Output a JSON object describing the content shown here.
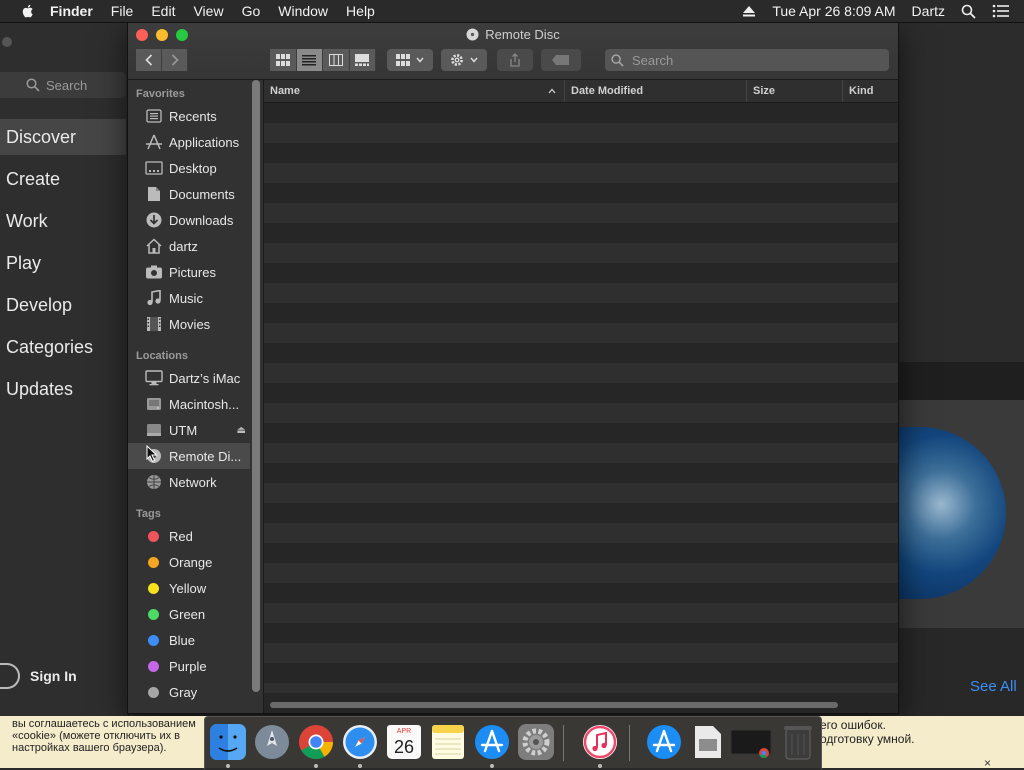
{
  "menubar": {
    "app_name": "Finder",
    "menus": [
      "File",
      "Edit",
      "View",
      "Go",
      "Window",
      "Help"
    ],
    "datetime": "Tue Apr 26  8:09 AM",
    "user": "Dartz"
  },
  "appstore": {
    "search_placeholder": "Search",
    "nav": [
      "Discover",
      "Create",
      "Work",
      "Play",
      "Develop",
      "Categories",
      "Updates"
    ],
    "active_nav": "Discover",
    "sign_in": "Sign In",
    "see_all": "See All"
  },
  "finder": {
    "title": "Remote Disc",
    "search_placeholder": "Search",
    "sidebar": {
      "favorites_label": "Favorites",
      "favorites": [
        {
          "label": "Recents",
          "icon": "recents-icon"
        },
        {
          "label": "Applications",
          "icon": "applications-icon"
        },
        {
          "label": "Desktop",
          "icon": "desktop-icon"
        },
        {
          "label": "Documents",
          "icon": "documents-icon"
        },
        {
          "label": "Downloads",
          "icon": "downloads-icon"
        },
        {
          "label": "dartz",
          "icon": "home-icon"
        },
        {
          "label": "Pictures",
          "icon": "pictures-icon"
        },
        {
          "label": "Music",
          "icon": "music-icon"
        },
        {
          "label": "Movies",
          "icon": "movies-icon"
        }
      ],
      "locations_label": "Locations",
      "locations": [
        {
          "label": "Dartz’s iMac",
          "icon": "imac-icon"
        },
        {
          "label": "Macintosh...",
          "icon": "hard-drive-icon"
        },
        {
          "label": "UTM",
          "icon": "external-drive-icon"
        },
        {
          "label": "Remote Di...",
          "icon": "remote-disc-icon"
        },
        {
          "label": "Network",
          "icon": "network-icon"
        }
      ],
      "tags_label": "Tags",
      "tags": [
        {
          "label": "Red",
          "color": "#f2545b"
        },
        {
          "label": "Orange",
          "color": "#f5a623"
        },
        {
          "label": "Yellow",
          "color": "#f5e21b"
        },
        {
          "label": "Green",
          "color": "#4cd964"
        },
        {
          "label": "Blue",
          "color": "#3a8ef6"
        },
        {
          "label": "Purple",
          "color": "#c467e8"
        },
        {
          "label": "Gray",
          "color": "#a6a6a6"
        }
      ]
    },
    "columns": [
      "Name",
      "Date Modified",
      "Size",
      "Kind"
    ]
  },
  "strip": {
    "left_text": "вы соглашаетесь с использованием «cookie» (можете отключить их в настройках вашего браузера).",
    "right_text_1": "его ошибок.",
    "right_text_2": "одготовку умной.",
    "close": "×"
  },
  "dock": {
    "apps": [
      "Finder",
      "Launchpad",
      "Chrome",
      "Safari",
      "Calendar",
      "Notes",
      "App Store",
      "System Preferences",
      "iTunes",
      "App Store",
      "Preview",
      "Chrome window",
      "Trash"
    ],
    "calendar_month": "APR",
    "calendar_day": "26"
  },
  "colors": {
    "accent": "#3b8ff5",
    "selection": "#4a4a4a"
  }
}
